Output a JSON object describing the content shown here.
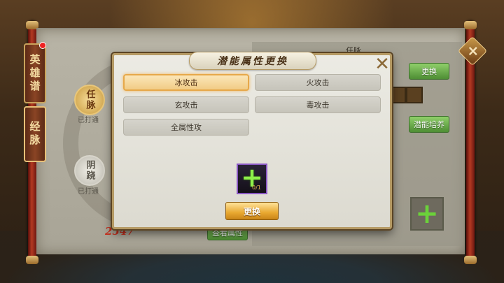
{
  "window": {
    "title": "潜能属性更换"
  },
  "left_tabs": [
    {
      "label": "英雄谱"
    },
    {
      "label": "经脉"
    }
  ],
  "meridians": [
    {
      "name": "任脉",
      "status": "已打通"
    },
    {
      "name": "阴跷",
      "status": "已打通"
    }
  ],
  "background": {
    "top_label": "任脉",
    "replace_button": "更换",
    "train_button": "潜能培养",
    "view_attr_button": "查看属性",
    "score_value": "2547"
  },
  "dialog": {
    "title": "潜能属性更换",
    "close_icon": "close-icon",
    "options": [
      {
        "label": "冰攻击",
        "selected": true
      },
      {
        "label": "火攻击",
        "selected": false
      },
      {
        "label": "玄攻击",
        "selected": false
      },
      {
        "label": "毒攻击",
        "selected": false
      },
      {
        "label": "全属性攻",
        "selected": false
      }
    ],
    "item_count": "0/1",
    "confirm_button": "更换"
  },
  "colors": {
    "selected_fill": "#f1cc86",
    "gold_button": "#e8a830",
    "green_button": "#4e8e34",
    "plus_green": "#8df04a"
  }
}
